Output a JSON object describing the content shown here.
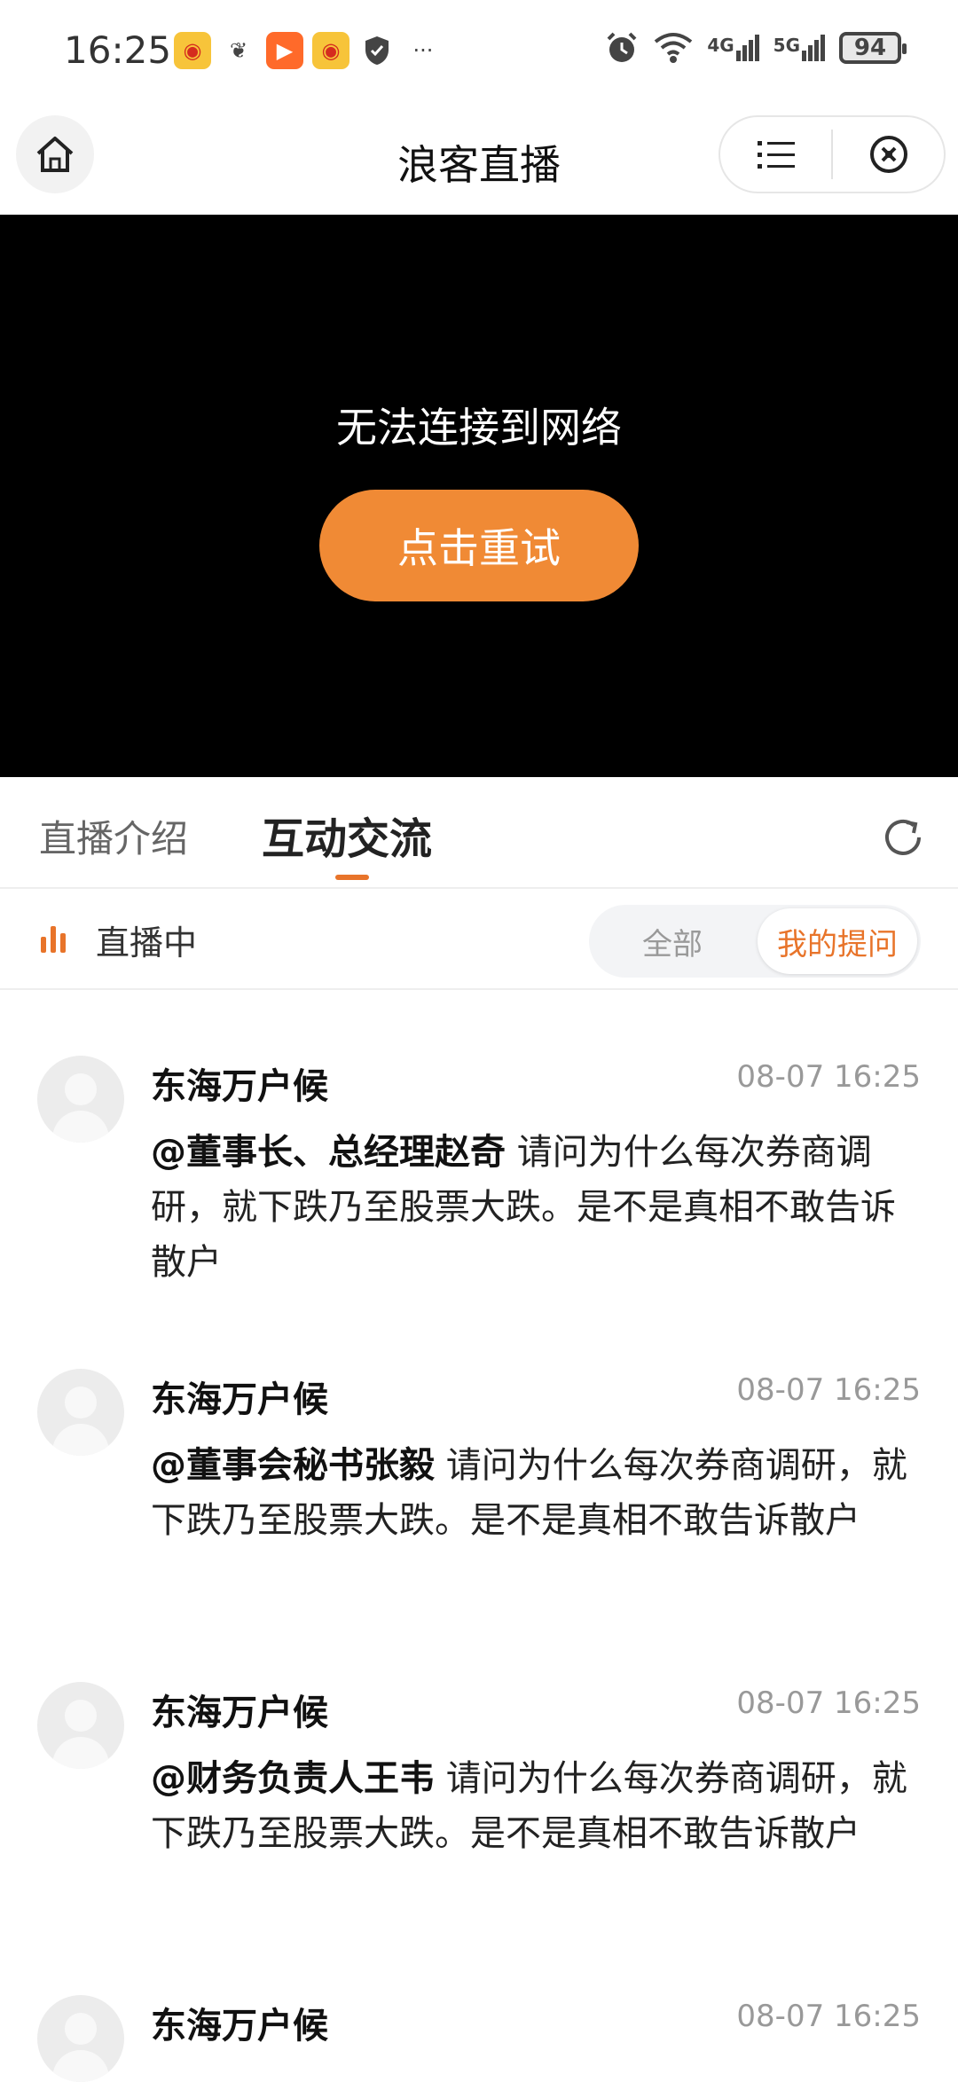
{
  "status_bar": {
    "time": "16:25",
    "signal_4g": "4G",
    "signal_5g": "5G",
    "battery": "94"
  },
  "header": {
    "title": "浪客直播"
  },
  "video": {
    "error_message": "无法连接到网络",
    "retry_label": "点击重试"
  },
  "tabs": {
    "intro": "直播介绍",
    "chat": "互动交流"
  },
  "filter": {
    "live_status": "直播中",
    "all_label": "全部",
    "mine_label": "我的提问"
  },
  "messages": [
    {
      "name": "东海万户候",
      "time": "08-07 16:25",
      "mention": "@董事长、总经理赵奇",
      "text": " 请问为什么每次券商调研，就下跌乃至股票大跌。是不是真相不敢告诉散户"
    },
    {
      "name": "东海万户候",
      "time": "08-07 16:25",
      "mention": "@董事会秘书张毅",
      "text": " 请问为什么每次券商调研，就下跌乃至股票大跌。是不是真相不敢告诉散户"
    },
    {
      "name": "东海万户候",
      "time": "08-07 16:25",
      "mention": "@财务负责人王韦",
      "text": " 请问为什么每次券商调研，就下跌乃至股票大跌。是不是真相不敢告诉散户"
    },
    {
      "name": "东海万户候",
      "time": "08-07 16:25",
      "mention": "",
      "text": ""
    }
  ],
  "colors": {
    "accent": "#f08a35",
    "tab_accent": "#e8742a"
  }
}
